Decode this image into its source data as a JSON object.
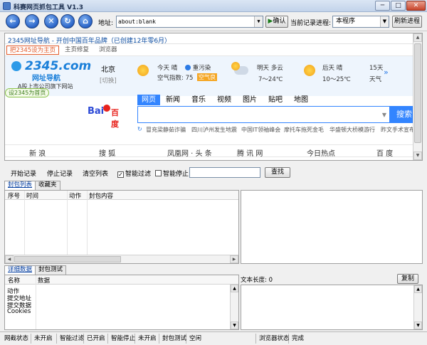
{
  "window": {
    "title": "科赛网页抓包工具 V1.3",
    "min": "─",
    "max": "□",
    "close": "✕"
  },
  "toolbar": {
    "address_label": "地址:",
    "address_value": "about:blank",
    "confirm_label": "确认",
    "process_label": "当前记录进程:",
    "process_value": "本程序",
    "refresh_label": "刷新进程"
  },
  "browser": {
    "top_text": "2345网址导航 - 开创中国百年品牌（已创建12年零6月）",
    "set_home_red": "把2345设为主页",
    "home_repair": "主页修复",
    "browser_link": "浏览器",
    "logo_main": "2345.com",
    "logo_sub": "网址导航",
    "logo_tag": "A股上市公司旗下网站",
    "home_pill": "设2345为首页",
    "city": "北京",
    "city_switch": "[切换]",
    "today": "今天  晴",
    "pollution": "重污染",
    "air_index": "空气指数: 75",
    "air_level": "空气良",
    "tomorrow": "明天  多云",
    "tomorrow_temp": "7～24℃",
    "after": "后天  晴",
    "after_temp": "10～25℃",
    "days15": "15天",
    "days15_sub": "天气",
    "baidu_logo_a": "Bai",
    "baidu_logo_b": "百度",
    "tabs": [
      "网页",
      "新闻",
      "音乐",
      "视频",
      "图片",
      "贴吧",
      "地图"
    ],
    "search_button": "搜索",
    "hot": [
      "冒充梁静茹诈骗",
      "四川泸州发生地震",
      "中国IT领袖峰会",
      "摩托车拖死金毛",
      "华盛顿大桥模游行",
      "昨文手术宣布"
    ],
    "links": [
      "新  浪",
      "搜  狐",
      "凤凰网 · 头  条",
      "腾 讯 网",
      "今日热点",
      "百  度"
    ]
  },
  "controls": {
    "start": "开始记录",
    "stop": "停止记录",
    "clear": "清空列表",
    "smart_filter": "智能过滤",
    "smart_stop": "智能停止",
    "find": "查找"
  },
  "packet_tabs": [
    "封包列表",
    "收藏夹"
  ],
  "packet_columns": [
    "序号",
    "时间",
    "动作",
    "封包内容"
  ],
  "detail_tabs": [
    "详细数据",
    "封包测试"
  ],
  "detail_columns": [
    "名称",
    "数据"
  ],
  "detail_rows": [
    "动作",
    "提交地址",
    "提交数据",
    "Cookies"
  ],
  "text_length": "文本长度: 0",
  "copy_label": "复制",
  "status": {
    "net_label": "网截状态",
    "net_value": "未开启",
    "filter_label": "智能过滤",
    "filter_value": "已开启",
    "stop_label": "智能停止",
    "stop_value": "未开启",
    "test_label": "封包测试",
    "test_value": "空闲",
    "browser_label": "浏览器状态",
    "browser_value": "完成"
  }
}
